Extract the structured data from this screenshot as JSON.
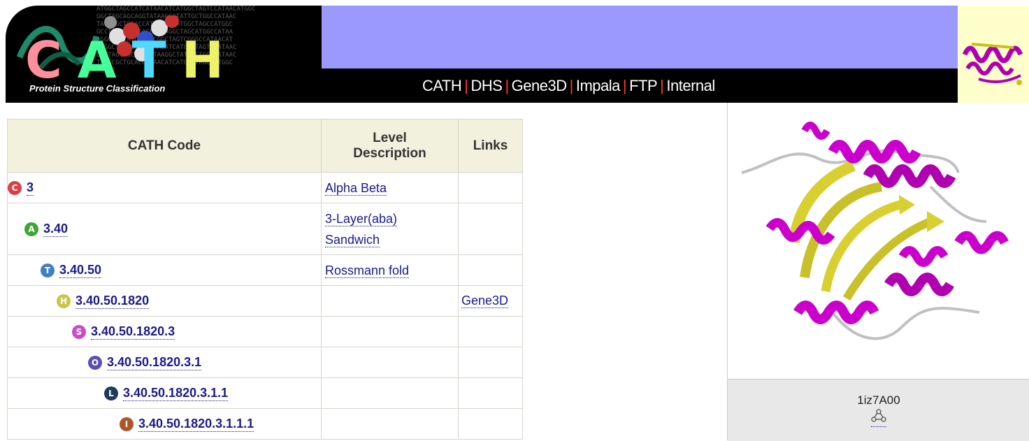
{
  "header": {
    "logo_letters": [
      {
        "char": "C",
        "color": "#ff8f9a"
      },
      {
        "char": "A",
        "color": "#45ff9a"
      },
      {
        "char": "T",
        "color": "#4fd9ff"
      },
      {
        "char": "H",
        "color": "#eef26a"
      }
    ],
    "logo_subtitle": "Protein Structure Classification",
    "nav": [
      {
        "label": "CATH"
      },
      {
        "label": "DHS"
      },
      {
        "label": "Gene3D"
      },
      {
        "label": "Impala"
      },
      {
        "label": "FTP"
      },
      {
        "label": "Internal"
      }
    ],
    "colors": {
      "banner": "#9b99fb",
      "nav_bg": "#000000",
      "nav_separator": "#ff3d1f"
    }
  },
  "table": {
    "headers": {
      "code": "CATH Code",
      "description_line1": "Level",
      "description_line2": "Description",
      "links": "Links"
    },
    "rows": [
      {
        "level_letter": "C",
        "icon_color": "#d9414a",
        "code": "3",
        "description_line1": "Alpha Beta",
        "description_line2": "",
        "link": ""
      },
      {
        "level_letter": "A",
        "icon_color": "#3fa636",
        "code": "3.40",
        "description_line1": "3-Layer(aba)",
        "description_line2": "Sandwich",
        "link": ""
      },
      {
        "level_letter": "T",
        "icon_color": "#3f7fc4",
        "code": "3.40.50",
        "description_line1": "Rossmann fold",
        "description_line2": "",
        "link": ""
      },
      {
        "level_letter": "H",
        "icon_color": "#c7c74a",
        "code": "3.40.50.1820",
        "description_line1": "",
        "description_line2": "",
        "link": "Gene3D"
      },
      {
        "level_letter": "S",
        "icon_color": "#c44fc4",
        "code": "3.40.50.1820.3",
        "description_line1": "",
        "description_line2": "",
        "link": ""
      },
      {
        "level_letter": "O",
        "icon_color": "#5a4fb0",
        "code": "3.40.50.1820.3.1",
        "description_line1": "",
        "description_line2": "",
        "link": ""
      },
      {
        "level_letter": "L",
        "icon_color": "#1f3b5c",
        "code": "3.40.50.1820.3.1.1",
        "description_line1": "",
        "description_line2": "",
        "link": ""
      },
      {
        "level_letter": "I",
        "icon_color": "#b0542a",
        "code": "3.40.50.1820.3.1.1.1",
        "description_line1": "",
        "description_line2": "",
        "link": ""
      }
    ]
  },
  "structure": {
    "domain_id": "1iz7A00",
    "icon": "molecule-icon",
    "colors": {
      "helix": "#cc00cc",
      "strand": "#d8d030",
      "coil": "#c0c0c0"
    }
  }
}
